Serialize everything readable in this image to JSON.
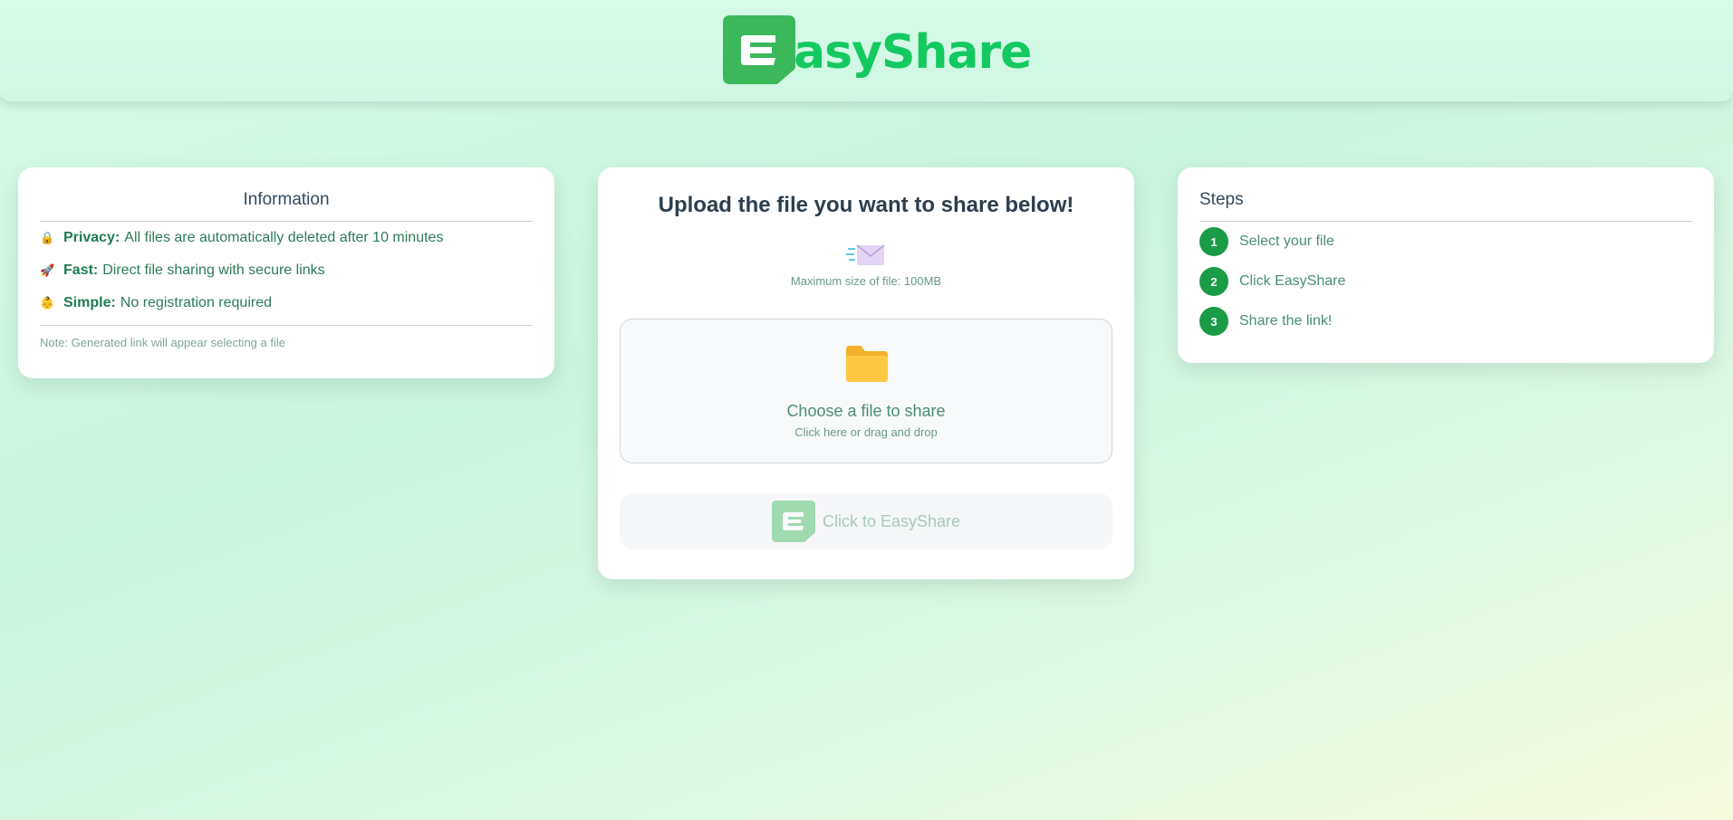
{
  "header": {
    "logo_text": "asyShare"
  },
  "info": {
    "title": "Information",
    "items": [
      {
        "icon": "lock-icon",
        "emoji": "🔒",
        "label": "Privacy:",
        "text": "All files are automatically deleted after 10 minutes"
      },
      {
        "icon": "rocket-icon",
        "emoji": "🚀",
        "label": "Fast:",
        "text": "Direct file sharing with secure links"
      },
      {
        "icon": "baby-icon",
        "emoji": "👶",
        "label": "Simple:",
        "text": "No registration required"
      }
    ],
    "note": "Note: Generated link will appear selecting a file"
  },
  "upload": {
    "title": "Upload the file you want to share below!",
    "max_size": "Maximum size of file: 100MB",
    "dropzone_title": "Choose a file to share",
    "dropzone_subtitle": "Click here or drag and drop",
    "button_label": "Click to EasyShare"
  },
  "steps": {
    "title": "Steps",
    "items": [
      {
        "number": "1",
        "label": "Select your file"
      },
      {
        "number": "2",
        "label": "Click EasyShare"
      },
      {
        "number": "3",
        "label": "Share the link!"
      }
    ]
  },
  "colors": {
    "brand": "#14c95f",
    "step_badge": "#1a9b45"
  }
}
